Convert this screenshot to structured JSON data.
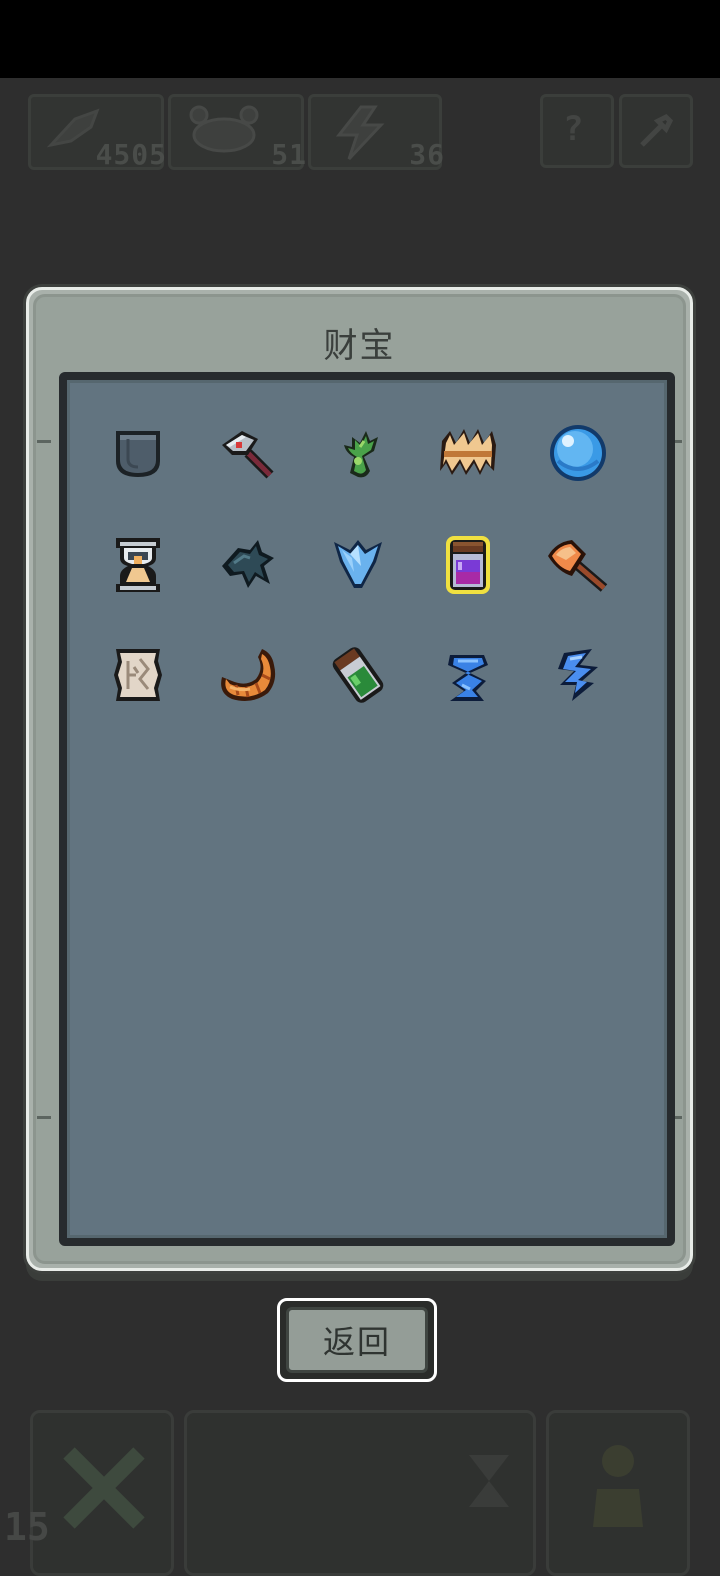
{
  "resources": {
    "feather_count": "4505",
    "crab_count": "51",
    "energy_count": "36"
  },
  "icons": {
    "resource1": "feather-icon",
    "resource2": "crab-icon",
    "resource3": "lightning-icon",
    "help": "question-icon",
    "settings": "wrench-icon"
  },
  "dialog": {
    "title": "财宝"
  },
  "treasures": [
    {
      "name": "pocket-icon"
    },
    {
      "name": "hammer-icon"
    },
    {
      "name": "green-sprout-icon"
    },
    {
      "name": "teeth-crown-icon"
    },
    {
      "name": "blue-orb-icon"
    },
    {
      "name": "hourglass-helmet-icon"
    },
    {
      "name": "dark-crow-icon"
    },
    {
      "name": "ice-crystal-icon"
    },
    {
      "name": "purple-potion-jar-icon"
    },
    {
      "name": "fire-axe-icon"
    },
    {
      "name": "ancient-scroll-icon"
    },
    {
      "name": "croissant-icon"
    },
    {
      "name": "green-potion-bottle-icon"
    },
    {
      "name": "blue-swirl-icon"
    },
    {
      "name": "blue-lightning-icon"
    }
  ],
  "selected_index": 8,
  "colors": {
    "selected_outline": "#f0e040",
    "panel_bg": "#627480",
    "dialog_bg": "#98a29b"
  },
  "footer": {
    "return_label": "返回",
    "counter": "15"
  }
}
